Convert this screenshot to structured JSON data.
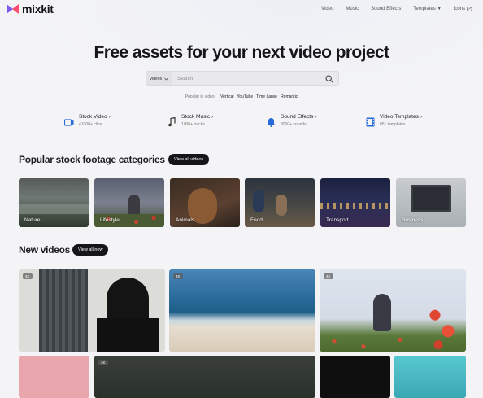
{
  "brand": {
    "name": "mixkit"
  },
  "nav": {
    "links": [
      {
        "label": "Video"
      },
      {
        "label": "Music"
      },
      {
        "label": "Sound Effects"
      },
      {
        "label": "Templates"
      },
      {
        "label": "Icons"
      }
    ]
  },
  "hero": {
    "title": "Free assets for your next video project"
  },
  "search": {
    "select_value": "Videos",
    "placeholder": "Search"
  },
  "popular": {
    "label": "Popular in video:",
    "tags": [
      "Vertical",
      "YouTube",
      "Time Lapse",
      "Romantic"
    ]
  },
  "categories": [
    {
      "title": "Stock Video",
      "count": "41000+ clips",
      "icon": "video-icon"
    },
    {
      "title": "Stock Music",
      "count": "1000+ tracks",
      "icon": "music-note-icon"
    },
    {
      "title": "Sound Effects",
      "count": "3000+ sounds",
      "icon": "bell-icon"
    },
    {
      "title": "Video Templates",
      "count": "851 templates",
      "icon": "film-icon"
    }
  ],
  "footage": {
    "title": "Popular stock footage categories",
    "button": "View all videos",
    "items": [
      {
        "label": "Nature"
      },
      {
        "label": "Lifestyle"
      },
      {
        "label": "Animals"
      },
      {
        "label": "Food"
      },
      {
        "label": "Transport"
      },
      {
        "label": "Business"
      }
    ]
  },
  "new_videos": {
    "title": "New videos",
    "button": "View all new",
    "badges": [
      "4K",
      "4K",
      "4K",
      "4K"
    ]
  },
  "colors": {
    "accent_purple": "#7f5af0",
    "accent_pink": "#ff4d6d",
    "pill_bg": "#16161a"
  }
}
